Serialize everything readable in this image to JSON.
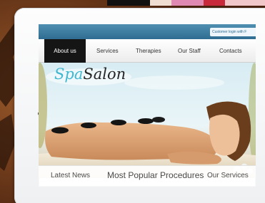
{
  "top_bar": {
    "login_text": "Customer login with F"
  },
  "nav": {
    "items": [
      {
        "label": "About us",
        "active": true
      },
      {
        "label": "Services",
        "active": false
      },
      {
        "label": "Therapies",
        "active": false
      },
      {
        "label": "Our Staff",
        "active": false
      },
      {
        "label": "Contacts",
        "active": false
      }
    ]
  },
  "logo": {
    "part1": "Spa",
    "part2": "Salon"
  },
  "bottom_links": {
    "left": "Latest News",
    "center": "Most Popular Procedures",
    "right": "Our Services"
  },
  "colors": {
    "top_bar": "#3d7ea3",
    "nav_active_bg": "#151515",
    "logo_accent": "#3fb8d0"
  }
}
